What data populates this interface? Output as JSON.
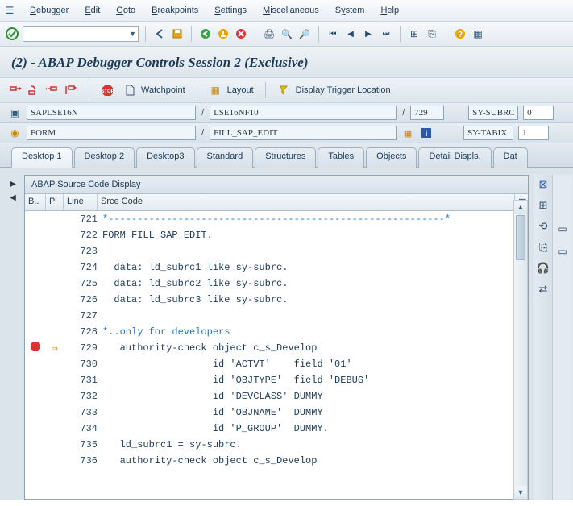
{
  "menu": {
    "items": [
      "Debugger",
      "Edit",
      "Goto",
      "Breakpoints",
      "Settings",
      "Miscellaneous",
      "System",
      "Help"
    ]
  },
  "title": "(2) - ABAP Debugger Controls Session 2 (Exclusive)",
  "apptool": {
    "watchpoint": "Watchpoint",
    "layout": "Layout",
    "trigger": "Display Trigger Location"
  },
  "fields": {
    "program": "SAPLSE16N",
    "include": "LSE16NF10",
    "line": "729",
    "event": "FORM",
    "routine": "FILL_SAP_EDIT",
    "sy_subrc_lbl": "SY-SUBRC",
    "sy_subrc": "0",
    "sy_tabix_lbl": "SY-TABIX",
    "sy_tabix": "1"
  },
  "tabs": [
    "Desktop 1",
    "Desktop 2",
    "Desktop3",
    "Standard",
    "Structures",
    "Tables",
    "Objects",
    "Detail Displs.",
    "Dat"
  ],
  "code_title": "ABAP Source Code Display",
  "columns": {
    "b": "B..",
    "p": "P",
    "line": "Line",
    "src": "Srce Code"
  },
  "code": [
    {
      "n": 721,
      "t": "*----------------------------------------------------------*",
      "cmt": true
    },
    {
      "n": 722,
      "t": "FORM FILL_SAP_EDIT."
    },
    {
      "n": 723,
      "t": ""
    },
    {
      "n": 724,
      "t": "  data: ld_subrc1 like sy-subrc."
    },
    {
      "n": 725,
      "t": "  data: ld_subrc2 like sy-subrc."
    },
    {
      "n": 726,
      "t": "  data: ld_subrc3 like sy-subrc."
    },
    {
      "n": 727,
      "t": ""
    },
    {
      "n": 728,
      "t": "*..only for developers",
      "cmt": true
    },
    {
      "n": 729,
      "t": "   authority-check object c_s_Develop",
      "bp": true,
      "cur": true
    },
    {
      "n": 730,
      "t": "                   id 'ACTVT'    field '01'"
    },
    {
      "n": 731,
      "t": "                   id 'OBJTYPE'  field 'DEBUG'"
    },
    {
      "n": 732,
      "t": "                   id 'DEVCLASS' DUMMY"
    },
    {
      "n": 733,
      "t": "                   id 'OBJNAME'  DUMMY"
    },
    {
      "n": 734,
      "t": "                   id 'P_GROUP'  DUMMY."
    },
    {
      "n": 735,
      "t": "   ld_subrc1 = sy-subrc."
    },
    {
      "n": 736,
      "t": "   authority-check object c_s_Develop"
    }
  ]
}
